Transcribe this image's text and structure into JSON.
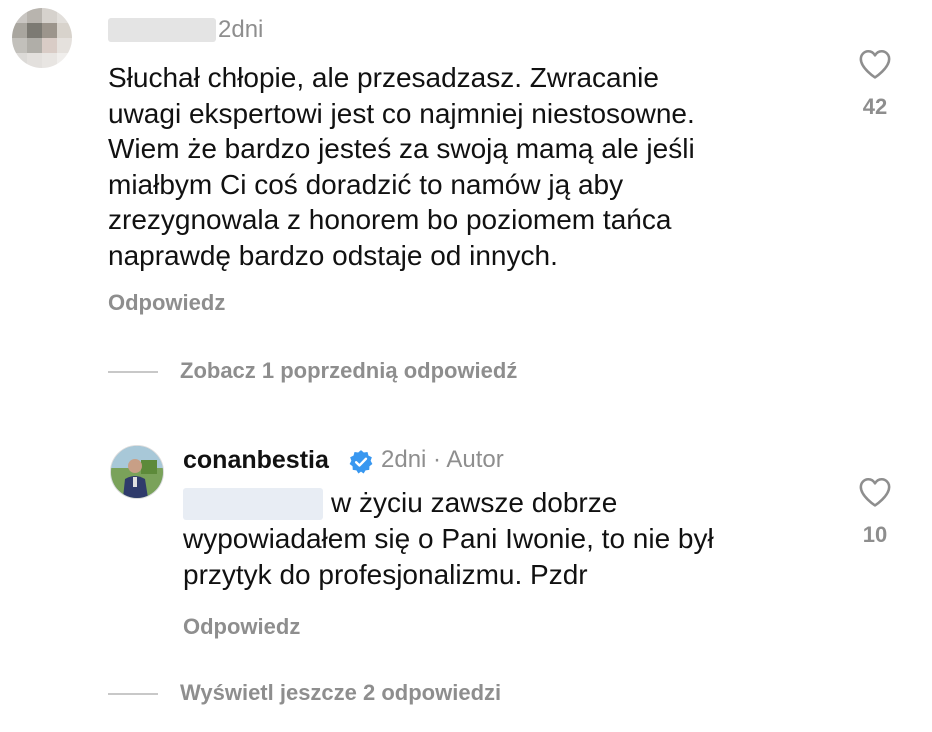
{
  "comment1": {
    "username_redacted": true,
    "time": "2dni",
    "text": "Słuchał chłopie, ale przesadzasz. Zwracanie\nuwagi ekspertowi jest co najmniej niestosowne.\nWiem że bardzo jesteś za swoją mamą  ale jeśli\nmiałbym Ci coś doradzić to namów ją aby\nzrezygnowala z honorem bo poziomem tańca\nnaprawdę bardzo odstaje od innych.",
    "reply_label": "Odpowiedz",
    "likes": "42",
    "view_previous": "Zobacz 1 poprzednią odpowiedź"
  },
  "comment2": {
    "username": "conanbestia",
    "time": "2dni",
    "separator": "·",
    "author_badge": "Autor",
    "text": "w życiu zawsze dobrze\nwypowiadałem się o Pani Iwonie, to nie był\nprzytyk do profesjonalizmu. Pzdr",
    "reply_label": "Odpowiedz",
    "likes": "10",
    "view_more": "Wyświetl jeszcze 2 odpowiedzi"
  },
  "icons": {
    "like": "heart-outline-icon",
    "verified": "verified-badge-icon"
  },
  "colors": {
    "secondary_text": "#8e8e8e",
    "verified_blue": "#3897f0"
  }
}
